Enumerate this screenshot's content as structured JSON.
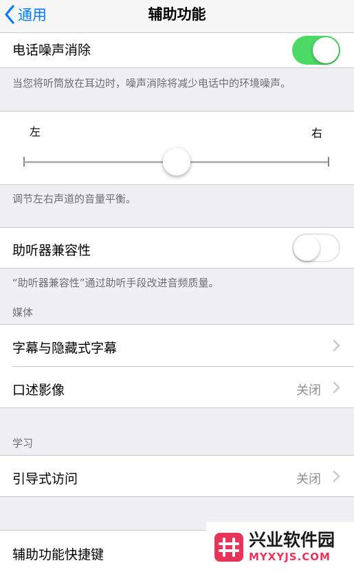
{
  "nav": {
    "back_label": "通用",
    "title": "辅助功能"
  },
  "noise_cancel": {
    "label": "电话噪声消除",
    "enabled": true,
    "footer": "当您将听筒放在耳边时，噪声消除将减少电话中的环境噪声。"
  },
  "balance": {
    "left_label": "左",
    "right_label": "右",
    "value": 0.5,
    "footer": "调节左右声道的音量平衡。"
  },
  "hearing_aid": {
    "label": "助听器兼容性",
    "enabled": false,
    "footer": "“助听器兼容性”通过助听手段改进音频质量。"
  },
  "media": {
    "header": "媒体",
    "items": [
      {
        "label": "字幕与隐藏式字幕",
        "value": ""
      },
      {
        "label": "口述影像",
        "value": "关闭"
      }
    ]
  },
  "learning": {
    "header": "学习",
    "items": [
      {
        "label": "引导式访问",
        "value": "关闭"
      }
    ]
  },
  "shortcut": {
    "label": "辅助功能快捷键"
  },
  "watermark": {
    "name": "兴业软件园",
    "url": "MYXYJS.COM"
  },
  "colors": {
    "accent": "#007aff",
    "toggle_on": "#4cd964",
    "background": "#efeff4",
    "watermark": "#e8345a"
  }
}
